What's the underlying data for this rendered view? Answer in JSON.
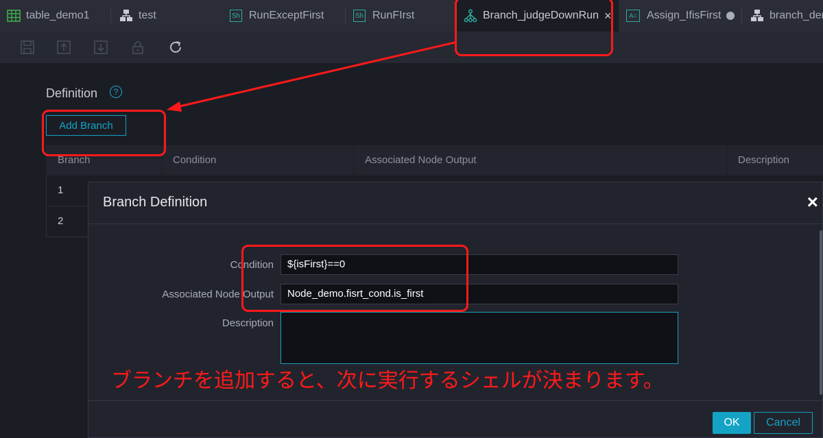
{
  "tabs": [
    {
      "label": "table_demo1",
      "icon": "table-icon"
    },
    {
      "label": "test",
      "icon": "hierarchy-icon"
    },
    {
      "label": "RunExceptFirst",
      "icon": "shell-icon",
      "icon_text": "Sh"
    },
    {
      "label": "RunFIrst",
      "icon": "shell-icon",
      "icon_text": "Sh"
    },
    {
      "label": "Branch_judgeDownRun",
      "icon": "branch-icon",
      "active": true,
      "close": "×"
    },
    {
      "label": "Assign_IfisFirst",
      "icon": "assign-icon",
      "icon_text": "A="
    },
    {
      "label": "branch_dem",
      "icon": "hierarchy-icon"
    }
  ],
  "toolbar": {
    "icons": [
      "save-icon",
      "submit-icon",
      "lock-icon",
      "unlock-icon",
      "refresh-icon"
    ]
  },
  "definition": {
    "title": "Definition",
    "help": "?",
    "add_branch_label": "Add Branch",
    "columns": [
      "Branch",
      "Condition",
      "Associated Node Output",
      "Description"
    ],
    "rows": [
      {
        "branch": "1"
      },
      {
        "branch": "2"
      }
    ]
  },
  "modal": {
    "title": "Branch Definition",
    "close": "×",
    "fields": {
      "condition_label": "Condition",
      "condition_value": "${isFirst}==0",
      "output_label": "Associated Node Output",
      "output_value": "Node_demo.fisrt_cond.is_first",
      "description_label": "Description",
      "description_value": ""
    },
    "ok_label": "OK",
    "cancel_label": "Cancel"
  },
  "annotation": {
    "text": "ブランチを追加すると、次に実行するシェルが決まります。",
    "color": "#ff1a1a"
  },
  "colors": {
    "accent": "#14a3c4",
    "background": "#1b1d25",
    "annotation": "#ff1a1a"
  }
}
